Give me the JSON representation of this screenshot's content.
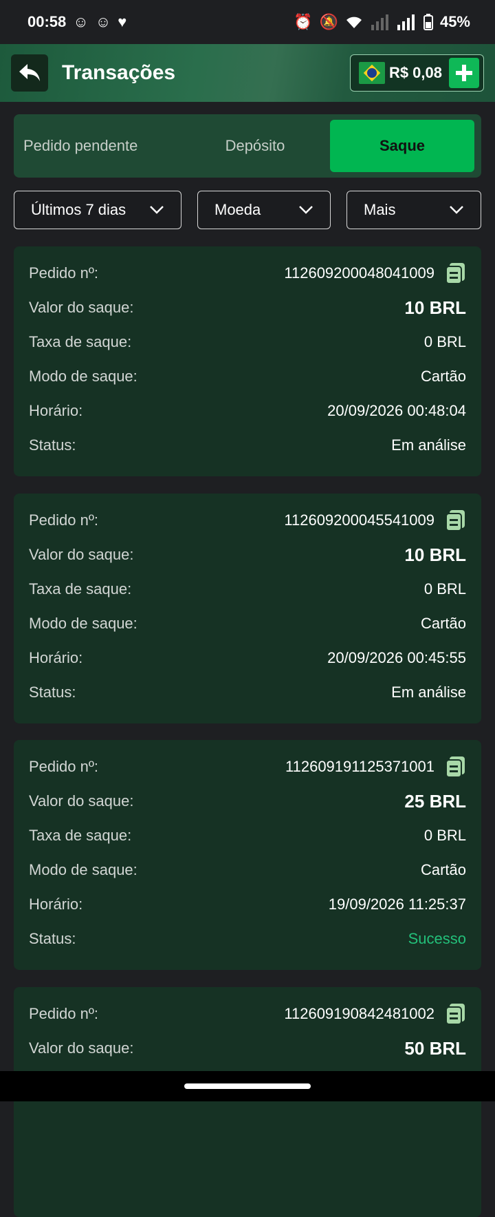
{
  "status_bar": {
    "time": "00:58",
    "battery": "45%"
  },
  "header": {
    "title": "Transações",
    "balance": "R$ 0,08"
  },
  "tabs": [
    {
      "label": "Pedido pendente"
    },
    {
      "label": "Depósito"
    },
    {
      "label": "Saque"
    }
  ],
  "filters": [
    {
      "label": "Últimos 7 dias"
    },
    {
      "label": "Moeda"
    },
    {
      "label": "Mais"
    }
  ],
  "labels": {
    "order": "Pedido nº:",
    "amount": "Valor do saque:",
    "fee": "Taxa de saque:",
    "mode": "Modo de saque:",
    "time": "Horário:",
    "status": "Status:"
  },
  "transactions": [
    {
      "order": "112609200048041009",
      "amount": "10 BRL",
      "fee": "0 BRL",
      "mode": "Cartão",
      "time": "20/09/2026 00:48:04",
      "status": "Em análise"
    },
    {
      "order": "112609200045541009",
      "amount": "10 BRL",
      "fee": "0 BRL",
      "mode": "Cartão",
      "time": "20/09/2026 00:45:55",
      "status": "Em análise"
    },
    {
      "order": "112609191125371001",
      "amount": "25 BRL",
      "fee": "0 BRL",
      "mode": "Cartão",
      "time": "19/09/2026 11:25:37",
      "status": "Sucesso"
    },
    {
      "order": "112609190842481002",
      "amount": "50 BRL"
    }
  ],
  "colors": {
    "accent": "#01b651",
    "success": "#23c07a",
    "card": "#163224"
  }
}
